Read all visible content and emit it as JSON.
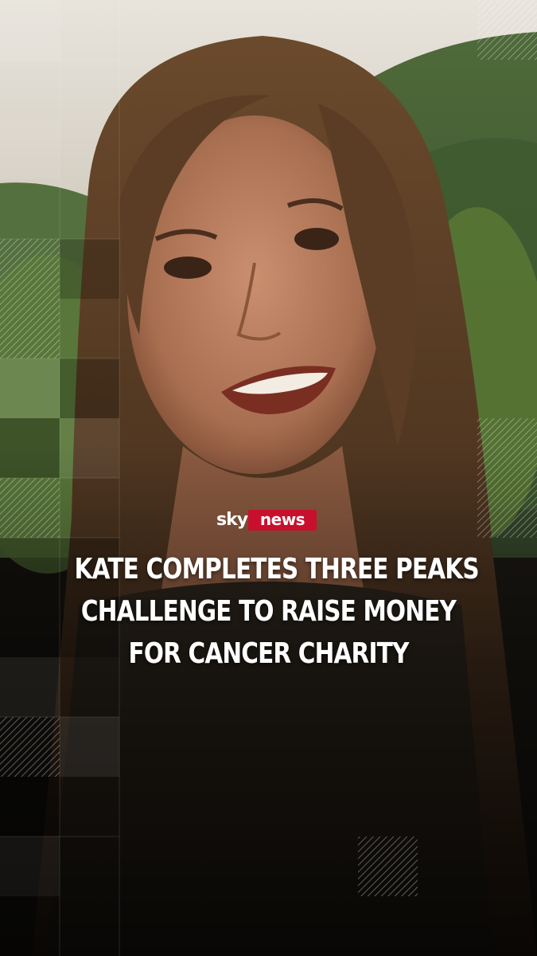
{
  "brand": {
    "logo_sky": "sky",
    "logo_news": "news",
    "accent_color": "#c8102e"
  },
  "headline": {
    "lines": [
      "KATE COMPLETES THREE PEAKS",
      "CHALLENGE TO RAISE MONEY",
      "FOR CANCER CHARITY"
    ]
  },
  "photo": {
    "subject": "woman smiling outdoors in front of green hills"
  }
}
